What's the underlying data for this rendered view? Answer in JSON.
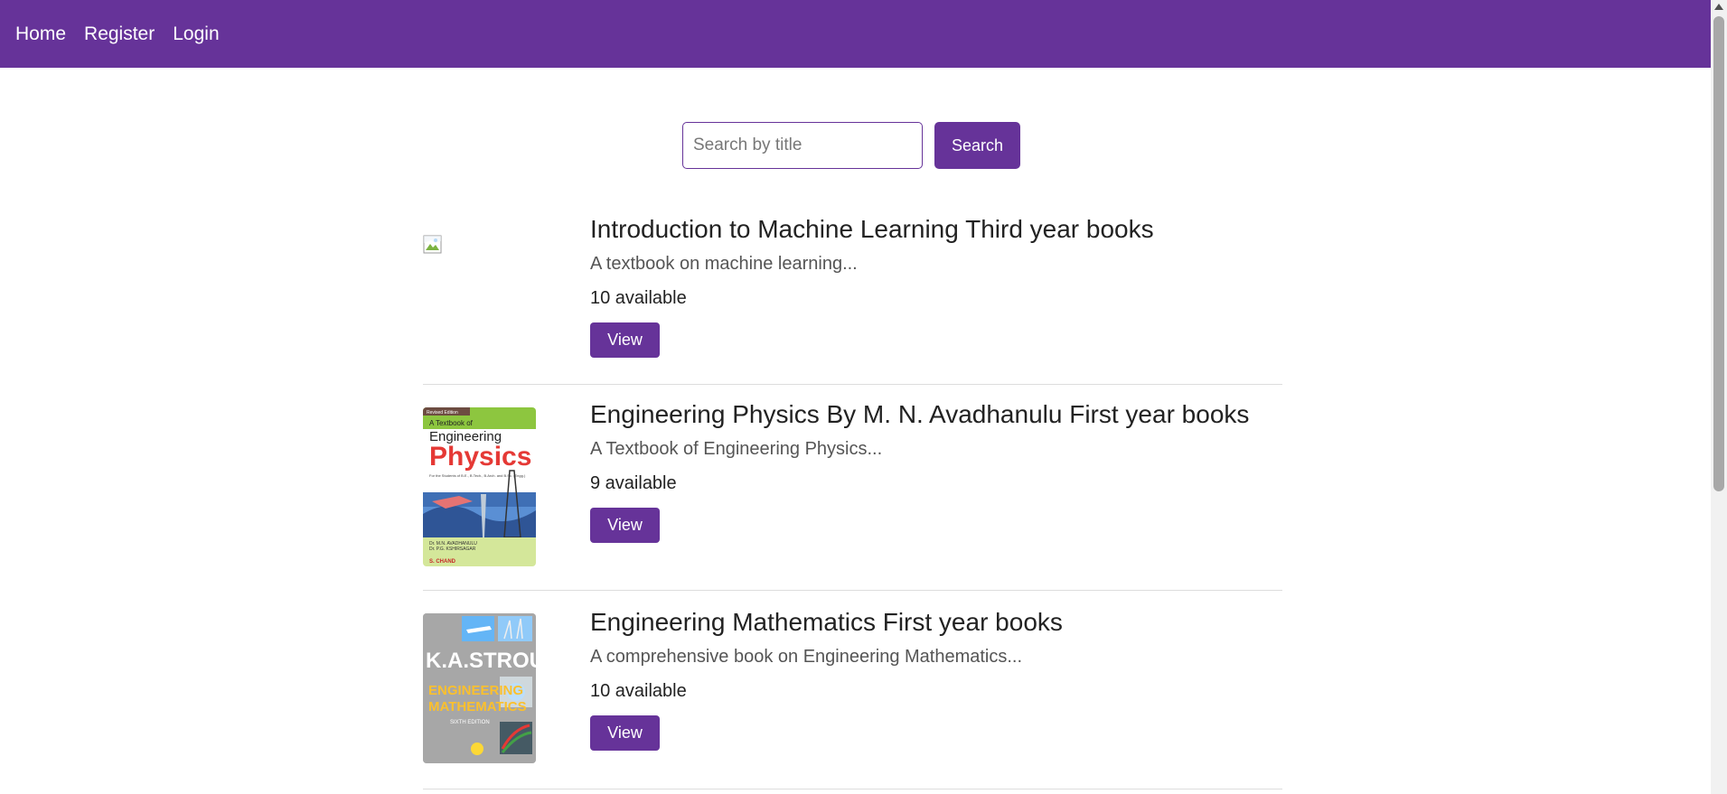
{
  "nav": {
    "home": "Home",
    "register": "Register",
    "login": "Login"
  },
  "search": {
    "placeholder": "Search by title",
    "button": "Search"
  },
  "books": [
    {
      "title": "Introduction to Machine Learning Third year books",
      "description": "A textbook on machine learning...",
      "availability": "10 available",
      "view_label": "View",
      "cover": "broken-image-icon"
    },
    {
      "title": "Engineering Physics By M. N. Avadhanulu First year books",
      "description": "A Textbook of Engineering Physics...",
      "availability": "9 available",
      "view_label": "View",
      "cover": {
        "edition": "Revised Edition",
        "line1": "A Textbook of",
        "line2": "Engineering",
        "line3": "Physics",
        "sub": "For the Students of B.E., B.Tech., B.Arch. and B.Sc. (Engg.)",
        "authors1": "Dr. M.N. AVADHANULU",
        "authors2": "Dr. P.G. KSHIRSAGAR",
        "publisher": "S. CHAND"
      }
    },
    {
      "title": "Engineering Mathematics First year books",
      "description": "A comprehensive book on Engineering Mathematics...",
      "availability": "10 available",
      "view_label": "View",
      "cover": {
        "author": "K.A.STROUD",
        "line1": "ENGINEERING",
        "line2": "MATHEMATICS",
        "edition": "SIXTH EDITION"
      }
    }
  ],
  "colors": {
    "brand": "#663399",
    "divider": "#dddddd"
  }
}
